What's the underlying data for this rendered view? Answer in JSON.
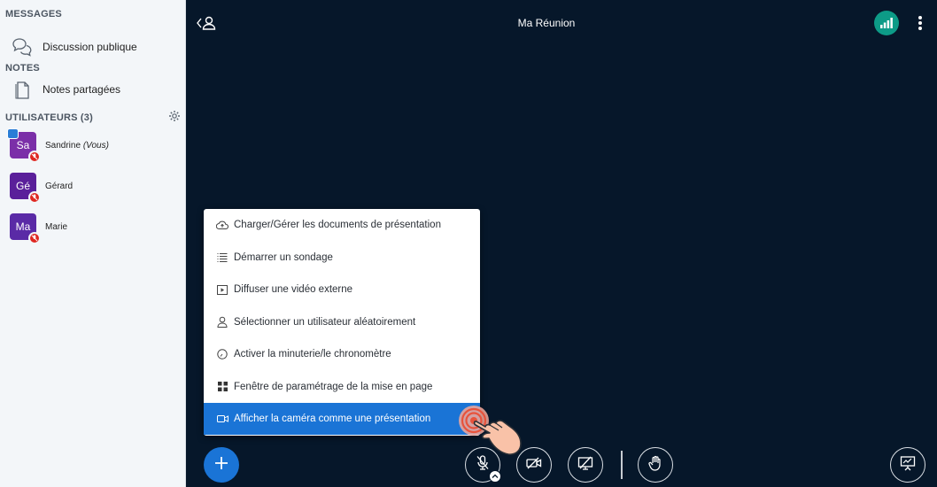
{
  "sidebar": {
    "messages_title": "MESSAGES",
    "public_chat": "Discussion publique",
    "notes_title": "NOTES",
    "shared_notes": "Notes partagées",
    "users_title": "UTILISATEURS (3)",
    "users": [
      {
        "initials": "Sa",
        "name": "Sandrine",
        "suffix": "(Vous)",
        "color": "#7b2fa8",
        "presenter": true
      },
      {
        "initials": "Gé",
        "name": "Gérard",
        "suffix": "",
        "color": "#5a1f9a",
        "presenter": false
      },
      {
        "initials": "Ma",
        "name": "Marie",
        "suffix": "",
        "color": "#5a2aa6",
        "presenter": false
      }
    ]
  },
  "header": {
    "title": "Ma Réunion"
  },
  "menu": {
    "items": [
      {
        "label": "Charger/Gérer les documents de présentation",
        "icon": "cloud-upload-icon"
      },
      {
        "label": "Démarrer un sondage",
        "icon": "poll-list-icon"
      },
      {
        "label": "Diffuser une vidéo externe",
        "icon": "external-video-icon"
      },
      {
        "label": "Sélectionner un utilisateur aléatoirement",
        "icon": "user-icon"
      },
      {
        "label": "Activer la minuterie/le chronomètre",
        "icon": "timer-icon"
      },
      {
        "label": "Fenêtre de paramétrage de la mise en page",
        "icon": "layout-grid-icon"
      },
      {
        "label": "Afficher la caméra comme une présentation",
        "icon": "camera-icon",
        "highlighted": true
      }
    ]
  },
  "colors": {
    "accent": "#1a74d6",
    "background": "#06172a",
    "connection": "#0d9b87",
    "muted": "#df2721"
  }
}
